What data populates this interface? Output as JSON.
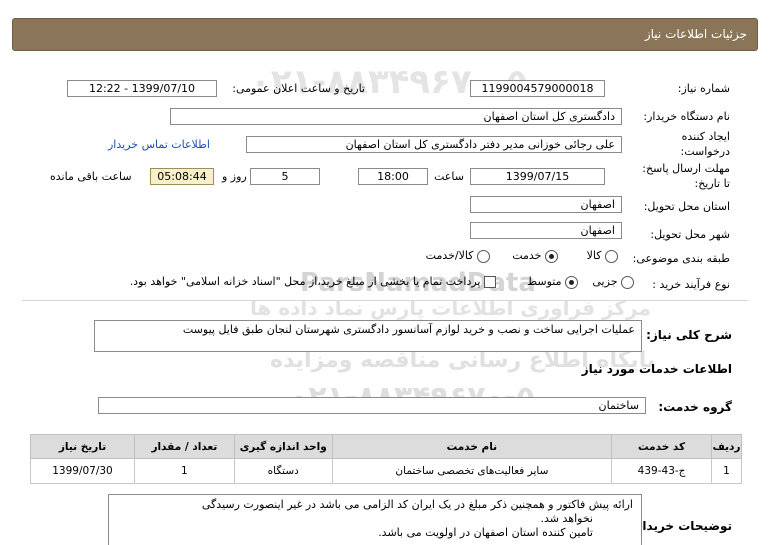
{
  "header": {
    "title": "جزئیات اطلاعات نیاز"
  },
  "fields": {
    "need_number_label": "شماره نیاز:",
    "need_number": "1199004579000018",
    "announce_label": "تاریخ و ساعت اعلان عمومی:",
    "announce_value": "1399/07/10 - 12:22",
    "buyer_org_label": "نام دستگاه خریدار:",
    "buyer_org": "دادگستری کل استان اصفهان",
    "creator_label_1": "ایجاد کننده",
    "creator_label_2": "درخواست:",
    "creator": "علی رجائی خوزانی مدیر دفتر دادگستری کل استان اصفهان",
    "contact_link": "اطلاعات تماس خریدار",
    "deadline_label_1": "مهلت ارسال پاسخ:",
    "deadline_label_2": "تا تاریخ:",
    "deadline_date": "1399/07/15",
    "time_label": "ساعت",
    "deadline_time": "18:00",
    "days_value": "5",
    "days_label": "روز و",
    "remaining_time": "05:08:44",
    "remaining_label": "ساعت باقی مانده",
    "province_label": "استان محل تحویل:",
    "province": "اصفهان",
    "city_label": "شهر محل تحویل:",
    "city": "اصفهان",
    "category_label": "طبقه بندی موضوعی:",
    "category_options": [
      "کالا",
      "خدمت",
      "کالا/خدمت"
    ],
    "purchase_label": "نوع فرآیند خرید :",
    "purchase_options": [
      "جزیی",
      "متوسط"
    ],
    "payment_text": "پرداخت تمام یا بخشی از مبلغ خرید،از محل \"اسناد خزانه اسلامی\" خواهد بود."
  },
  "description": {
    "label": "شرح کلی نیاز:",
    "text": "عملیات اجرایی ساخت و نصب و خرید لوازم آسانسور دادگستری شهرستان لنجان طبق فایل پیوست"
  },
  "services_section": {
    "title": "اطلاعات خدمات مورد نیاز",
    "group_label": "گروه خدمت:",
    "group_value": "ساختمان"
  },
  "table": {
    "headers": [
      "ردیف",
      "کد خدمت",
      "نام خدمت",
      "واحد اندازه گیری",
      "تعداد / مقدار",
      "تاریخ نیاز"
    ],
    "rows": [
      [
        "1",
        "ج-43-439",
        "سایر فعالیت‌های تخصصی ساختمان",
        "دستگاه",
        "1",
        "1399/07/30"
      ]
    ]
  },
  "buyer_notes": {
    "label": "توضیحات خریدار:",
    "lines": [
      "ارائه پیش فاکتور و همچنین ذکر مبلغ در یک ایران کد الزامی می باشد در غیر اینصورت رسیدگی",
      "نخواهد شد.",
      "تامین کننده استان اصفهان در اولویت می باشد."
    ]
  },
  "watermark": {
    "brand": "ParsNamadData",
    "phone": "۰۲۱-۸۸۳۴۹۶۷۰-۵",
    "subtitle": "مرکز فراوری اطلاعات پارس نماد داده ها",
    "portal": "پایگاه اطلاع رسانی مناقصه ومزایده"
  }
}
